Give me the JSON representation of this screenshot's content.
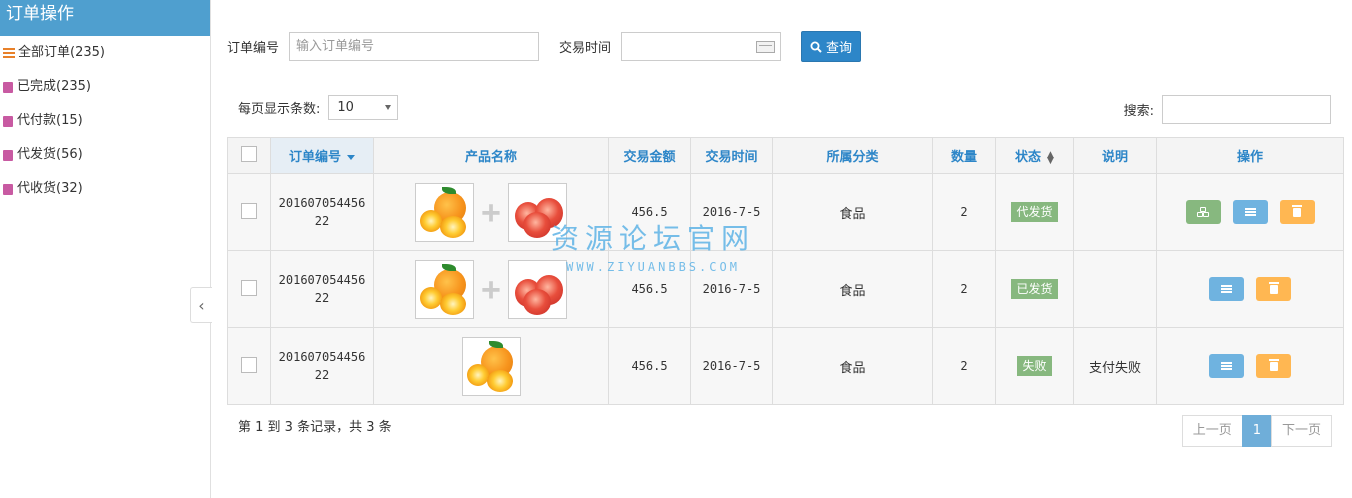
{
  "sidebar": {
    "title": "订单操作",
    "items": [
      {
        "label": "全部订单(235)",
        "icon": "list-icon"
      },
      {
        "label": "已完成(235)",
        "icon": "document-icon"
      },
      {
        "label": "代付款(15)",
        "icon": "document-icon"
      },
      {
        "label": "代发货(56)",
        "icon": "document-icon"
      },
      {
        "label": "代收货(32)",
        "icon": "document-icon"
      }
    ],
    "collapse_glyph": "‹"
  },
  "search": {
    "order_no_label": "订单编号",
    "order_no_placeholder": "输入订单编号",
    "time_label": "交易时间",
    "query_label": "查询"
  },
  "list": {
    "page_size_label": "每页显示条数:",
    "page_size_value": "10",
    "filter_label": "搜索:"
  },
  "table": {
    "headers": [
      "订单编号",
      "产品名称",
      "交易金额",
      "交易时间",
      "所属分类",
      "数量",
      "状态",
      "说明",
      "操作"
    ],
    "rows": [
      {
        "order_no_a": "201607054456",
        "order_no_b": "22",
        "amount": "456.5",
        "date": "2016-7-5",
        "category": "食品",
        "qty": "2",
        "status": "代发货",
        "note": "",
        "products": "orange+apple",
        "actions": [
          "detail",
          "edit",
          "delete"
        ]
      },
      {
        "order_no_a": "201607054456",
        "order_no_b": "22",
        "amount": "456.5",
        "date": "2016-7-5",
        "category": "食品",
        "qty": "2",
        "status": "已发货",
        "note": "",
        "products": "orange+apple",
        "actions": [
          "edit",
          "delete"
        ]
      },
      {
        "order_no_a": "201607054456",
        "order_no_b": "22",
        "amount": "456.5",
        "date": "2016-7-5",
        "category": "食品",
        "qty": "2",
        "status": "失败",
        "note": "支付失败",
        "products": "orange",
        "actions": [
          "edit",
          "delete"
        ]
      }
    ]
  },
  "footer": {
    "info": "第 1 到 3 条记录，共 3 条",
    "prev": "上一页",
    "current": "1",
    "next": "下一页"
  },
  "watermark": {
    "line1": "资源论坛官网",
    "line2": "WWW.ZIYUANBBS.COM"
  },
  "colors": {
    "accent": "#2d86c8",
    "sidebar_header": "#4f9fcf",
    "status_green": "#87b87f",
    "button_blue": "#6fb3e0",
    "button_yellow": "#ffb752"
  }
}
